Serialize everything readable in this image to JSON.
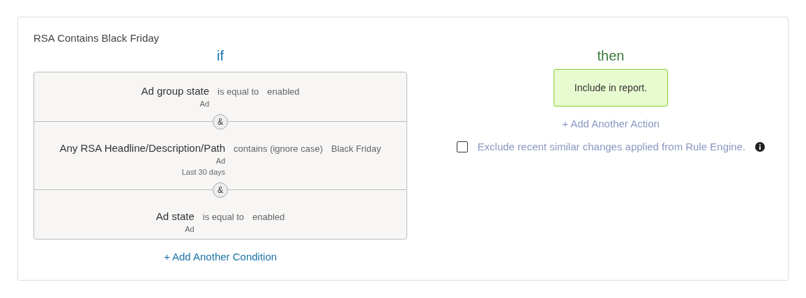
{
  "rule": {
    "title": "RSA Contains Black Friday",
    "if_label": "if",
    "conditions": [
      {
        "field": "Ad group state",
        "scope": [
          "Ad"
        ],
        "operator": "is equal to",
        "value": "enabled"
      },
      {
        "field": "Any RSA Headline/Description/Path",
        "scope": [
          "Ad",
          "Last 30 days"
        ],
        "operator": "contains (ignore case)",
        "value": "Black Friday"
      },
      {
        "field": "Ad state",
        "scope": [
          "Ad"
        ],
        "operator": "is equal to",
        "value": "enabled"
      }
    ],
    "joiners": [
      "&",
      "&"
    ],
    "add_condition": "+ Add Another Condition",
    "then_label": "then",
    "actions": [
      "Include in report."
    ],
    "add_action": "+ Add Another Action",
    "exclude": {
      "label": "Exclude recent similar changes applied from Rule Engine.",
      "checked": false
    }
  }
}
